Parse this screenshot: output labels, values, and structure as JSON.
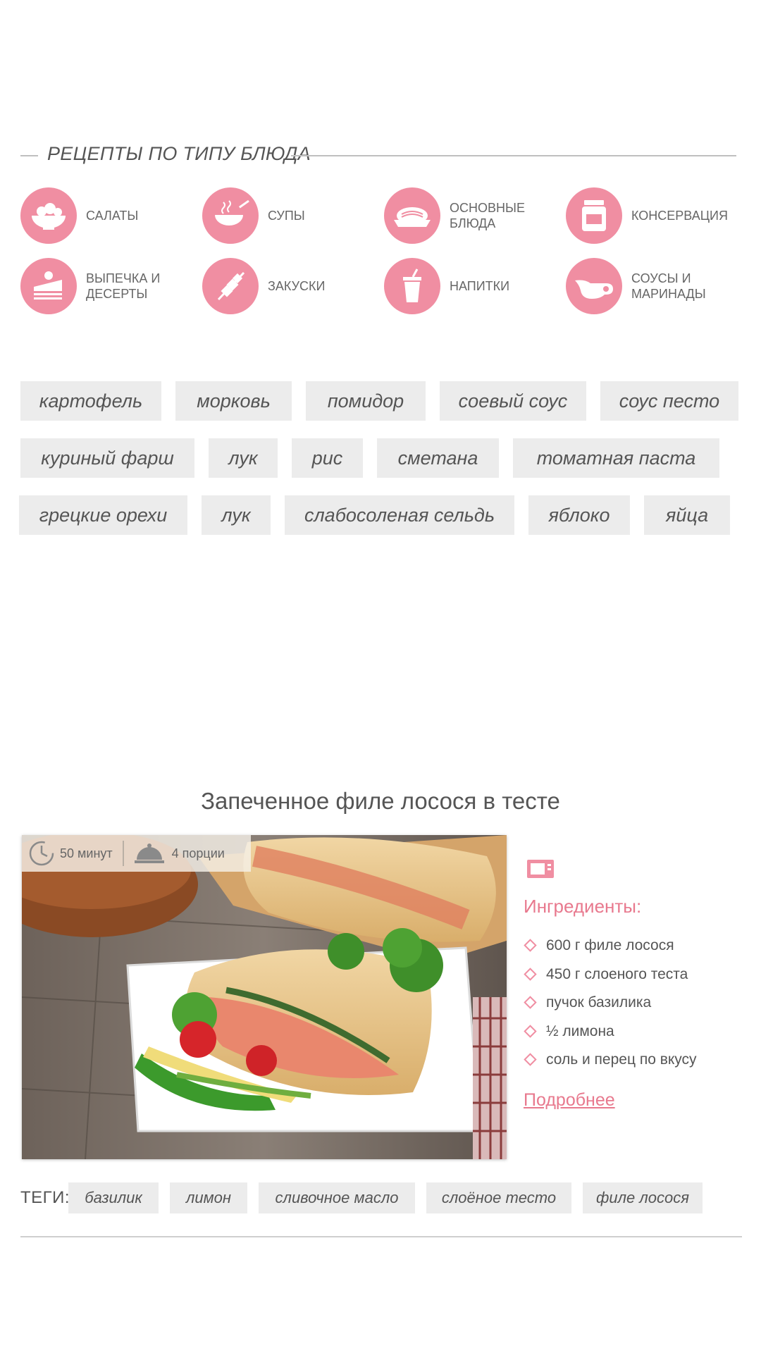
{
  "section": {
    "title": "РЕЦЕПТЫ ПО ТИПУ БЛЮДА"
  },
  "categories": [
    {
      "label": "САЛАТЫ",
      "icon": "salad-bowl-icon"
    },
    {
      "label": "СУПЫ",
      "icon": "soup-bowl-icon"
    },
    {
      "label": "ОСНОВНЫЕ БЛЮДА",
      "icon": "main-dish-icon"
    },
    {
      "label": "КОНСЕРВАЦИЯ",
      "icon": "jar-icon"
    },
    {
      "label": "ВЫПЕЧКА И ДЕСЕРТЫ",
      "icon": "cake-icon"
    },
    {
      "label": "ЗАКУСКИ",
      "icon": "skewer-icon"
    },
    {
      "label": "НАПИТКИ",
      "icon": "drink-cup-icon"
    },
    {
      "label": "СОУСЫ И МАРИНАДЫ",
      "icon": "gravy-boat-icon"
    }
  ],
  "ingredient_chips": [
    [
      "картофель",
      "морковь",
      "помидор",
      "соевый соус",
      "соус песто"
    ],
    [
      "куриный фарш",
      "лук",
      "рис",
      "сметана",
      "томатная паста"
    ],
    [
      "грецкие орехи",
      "лук",
      "слабосоленая сельдь",
      "яблоко",
      "яйца"
    ]
  ],
  "recipe": {
    "title": "Запеченное филе лосося в тесте",
    "time": "50 минут",
    "portions": "4 порции",
    "appliance_icon": "microwave-icon",
    "ingredients_heading": "Ингредиенты:",
    "ingredients": [
      "600 г филе лосося",
      "450 г слоеного теста",
      "пучок базилика",
      "½ лимона",
      "соль и перец по вкусу"
    ],
    "more_link": "Подробнее",
    "tags_label": "ТЕГИ:",
    "tags": [
      "базилик",
      "лимон",
      "сливочное масло",
      "слоёное тесто",
      "филе лосося"
    ]
  },
  "colors": {
    "accent": "#f08ea2",
    "accent_text": "#e8798e",
    "chip_bg": "#ececec",
    "rule": "#cfcfcf"
  }
}
